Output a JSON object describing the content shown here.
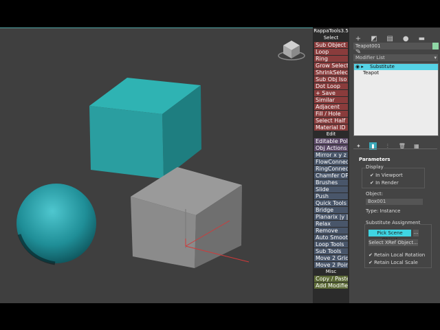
{
  "rappatools": {
    "title": "RappaTools3.5",
    "section_select": "Select",
    "section_edit": "Edit",
    "section_misc": "Misc",
    "select_buttons": [
      "Sub Object",
      "Loop",
      "Ring",
      "Grow Select",
      "ShrinkSelect",
      "Sub Obj Iso",
      "Dot Loop",
      "+ Save",
      "Similar",
      "Adjacent",
      "Fill / Hole",
      "Select Half",
      "Material ID"
    ],
    "edit_buttons": [
      "Editable Poly",
      "Obj Actions",
      "Mirror  x  y  z",
      "FlowConnect",
      "RingConnect",
      "Chamfer OP",
      "Brushes",
      "Slide",
      "Push",
      "Quick Tools",
      "Bridge",
      "Planarix |y |z",
      "Relax",
      "Remove",
      "Auto Smooth",
      "Loop Tools",
      "Sub Tools",
      "Move 2 Grid",
      "Move 2 Point"
    ],
    "misc_buttons": [
      "Copy / Paste",
      "Add Modifier"
    ]
  },
  "command_panel": {
    "object_name": "Teapot001",
    "modifier_list": "Modifier List",
    "stack": [
      {
        "label": "Substitute",
        "selected": true
      },
      {
        "label": "Teapot",
        "selected": false
      }
    ]
  },
  "parameters": {
    "title": "Parameters",
    "display_label": "Display",
    "in_viewport": "In Viewport",
    "in_render": "In Render",
    "object_label": "Object:",
    "object_value": "Box001",
    "type_label": "Type: Instance",
    "substitute_assignment": "Substitute Assignment",
    "pick_scene_object": "Pick Scene Object",
    "dots": "...",
    "select_xref": "Select XRef Object...",
    "retain_rotation": "Retain Local Rotation",
    "retain_scale": "Retain Local Scale"
  },
  "colors": {
    "teal_box": "#2a9ea0",
    "grey_box": "#8e8e8e",
    "viewport_bg": "#3f3f3f",
    "selection_highlight": "#55d3e6"
  }
}
